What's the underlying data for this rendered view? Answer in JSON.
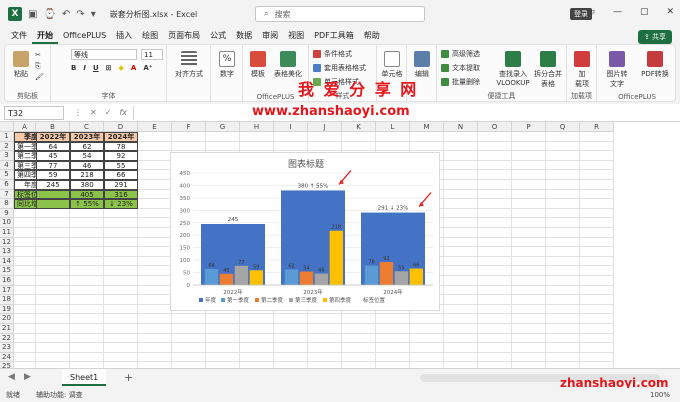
{
  "titlebar": {
    "doc_title": "嵌套分析图.xlsx - Excel",
    "search_placeholder": "搜索",
    "login": "登录"
  },
  "tabs": [
    "文件",
    "开始",
    "OfficePLUS",
    "插入",
    "绘图",
    "页面布局",
    "公式",
    "数据",
    "审阅",
    "视图",
    "PDF工具箱",
    "帮助"
  ],
  "active_tab": "开始",
  "share_label": "共享",
  "ribbon": {
    "groups": {
      "clipboard": "剪贴板",
      "font": "字体",
      "align": "对齐方式",
      "number": "数字",
      "officeplus": "OfficePLUS",
      "style": "样式",
      "cells": "单元格",
      "edit": "编辑",
      "convenience": "便捷工具",
      "addin": "加载项",
      "officeplus2": "OfficePLUS"
    },
    "font_name": "等线",
    "font_size": "11",
    "btn_paste": "粘贴",
    "btn_align": "对齐方式",
    "btn_number": "数字",
    "btn_template": "模板",
    "btn_beautify": "表格美化",
    "btn_cond": "条件格式",
    "btn_tablefmt": "套用表格格式",
    "btn_cellstyle": "单元格样式",
    "btn_cells": "单元格",
    "btn_edit": "编辑",
    "btn_adv": "高级筛选",
    "btn_extract": "文本提取",
    "btn_batch": "批量删除",
    "btn_vlookup_1": "查找录入",
    "btn_vlookup_2": "VLOOKUP",
    "btn_split_1": "拆分合并",
    "btn_split_2": "表格",
    "btn_addin_1": "加",
    "btn_addin_2": "载项",
    "btn_img_1": "图片转",
    "btn_img_2": "文字",
    "btn_pdf": "PDF转换"
  },
  "watermark": {
    "line1": "我 爱 分 享 网",
    "line2": "www.zhanshaoyi.com",
    "bottom": "zhanshaoyi.com"
  },
  "namebox": "T32",
  "fx": "fx",
  "columns": [
    "A",
    "B",
    "C",
    "D",
    "E",
    "F",
    "G",
    "H",
    "I",
    "J",
    "K",
    "L",
    "M",
    "N",
    "O",
    "P",
    "Q",
    "R"
  ],
  "rows": [
    "1",
    "2",
    "3",
    "4",
    "5",
    "6",
    "7",
    "8",
    "9",
    "10",
    "11",
    "12",
    "13",
    "14",
    "15",
    "16",
    "17",
    "18",
    "19",
    "20",
    "21",
    "22",
    "23",
    "24",
    "25"
  ],
  "table": {
    "header": [
      "季度",
      "2022年",
      "2023年",
      "2024年"
    ],
    "body": [
      [
        "第一季度",
        "64",
        "62",
        "78"
      ],
      [
        "第二季度",
        "45",
        "54",
        "92"
      ],
      [
        "第三季度",
        "77",
        "46",
        "55"
      ],
      [
        "第四季度",
        "59",
        "218",
        "66"
      ],
      [
        "年度",
        "245",
        "380",
        "291"
      ],
      [
        "标签位置",
        "",
        "405",
        "316"
      ],
      [
        "同比增长",
        "",
        "↑  55%",
        "↓  23%"
      ]
    ]
  },
  "chart_data": {
    "type": "bar",
    "title": "图表标题",
    "categories": [
      "2022年",
      "2023年",
      "2024年"
    ],
    "ylim": [
      0,
      450
    ],
    "yticks": [
      0,
      50,
      100,
      150,
      200,
      250,
      300,
      350,
      400,
      450
    ],
    "series": [
      {
        "name": "年度",
        "values": [
          245,
          380,
          291
        ],
        "color": "#4472c4"
      },
      {
        "name": "第一季度",
        "values": [
          64,
          62,
          78
        ],
        "color": "#5b9bd5"
      },
      {
        "name": "第二季度",
        "values": [
          45,
          54,
          92
        ],
        "color": "#ed7d31"
      },
      {
        "name": "第三季度",
        "values": [
          77,
          46,
          55
        ],
        "color": "#a5a5a5"
      },
      {
        "name": "第四季度",
        "values": [
          59,
          218,
          66
        ],
        "color": "#ffc000"
      },
      {
        "name": "标签位置",
        "values": [
          null,
          405,
          316
        ],
        "color": "#ffffff"
      }
    ],
    "annotations": [
      "",
      "↑ 55%",
      "↓ 23%"
    ],
    "legend_position": "bottom"
  },
  "sheet": {
    "name": "Sheet1",
    "add": "+"
  },
  "status": {
    "ready": "就绪",
    "accessibility": "辅助功能: 调查",
    "zoom": "100%"
  }
}
